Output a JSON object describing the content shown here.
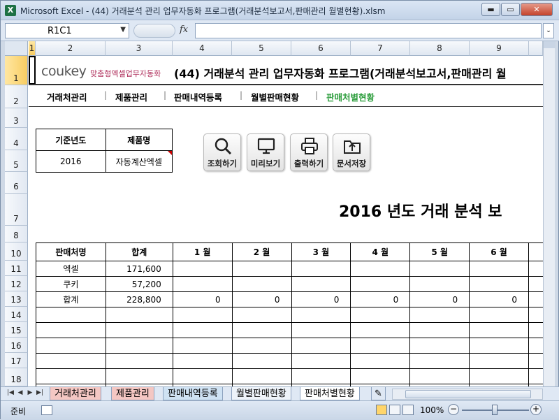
{
  "window": {
    "title": "Microsoft Excel - (44) 거래분석 관리 업무자동화 프로그램(거래분석보고서,판매관리 월별현황).xlsm",
    "app_icon": "X",
    "min": "▬",
    "max": "▭",
    "close": "✕"
  },
  "formula_bar": {
    "name_box": "R1C1",
    "fx": "fx",
    "formula": ""
  },
  "columns": [
    "1",
    "2",
    "3",
    "4",
    "5",
    "6",
    "7",
    "8",
    "9"
  ],
  "rows": [
    "1",
    "2",
    "3",
    "4",
    "5",
    "6",
    "7",
    "8",
    "10",
    "11",
    "12",
    "13",
    "14",
    "15",
    "16",
    "17",
    "18"
  ],
  "header": {
    "logo": "coukey",
    "logo_sub": "맞춤형엑셀업무자동화",
    "title": "(44) 거래분석 관리 업무자동화 프로그램(거래분석보고서,판매관리 월"
  },
  "nav": {
    "items": [
      "거래처관리",
      "제품관리",
      "판매내역등록",
      "월별판매현황",
      "판매처별현황"
    ],
    "active_color": "#2e9e3e"
  },
  "filter": {
    "year_label": "기준년도",
    "product_label": "제품명",
    "year_value": "2016",
    "product_value": "자동계산엑셀"
  },
  "buttons": {
    "search": "조회하기",
    "preview": "미리보기",
    "print": "출력하기",
    "save": "문서저장"
  },
  "report": {
    "title": "2016 년도 거래 분석 보"
  },
  "table": {
    "headers": [
      "판매처명",
      "합계",
      "1 월",
      "2 월",
      "3 월",
      "4 월",
      "5 월",
      "6 월"
    ],
    "rows": [
      {
        "name": "엑셀",
        "total": "171,600",
        "months": [
          "",
          "",
          "",
          "",
          "",
          ""
        ]
      },
      {
        "name": "쿠키",
        "total": "57,200",
        "months": [
          "",
          "",
          "",
          "",
          "",
          ""
        ]
      },
      {
        "name": "합계",
        "total": "228,800",
        "months": [
          "0",
          "0",
          "0",
          "0",
          "0",
          "0"
        ]
      }
    ]
  },
  "sheet_tabs": [
    "거래처관리",
    "제품관리",
    "판매내역등록",
    "월별판매현황",
    "판매처별현황"
  ],
  "sheet_tab_colors": [
    "#f4c7c3",
    "#f4c7c3",
    "#cfe2f3",
    "#ffffff",
    "#ffffff"
  ],
  "status": {
    "ready": "준비",
    "zoom": "100%"
  }
}
